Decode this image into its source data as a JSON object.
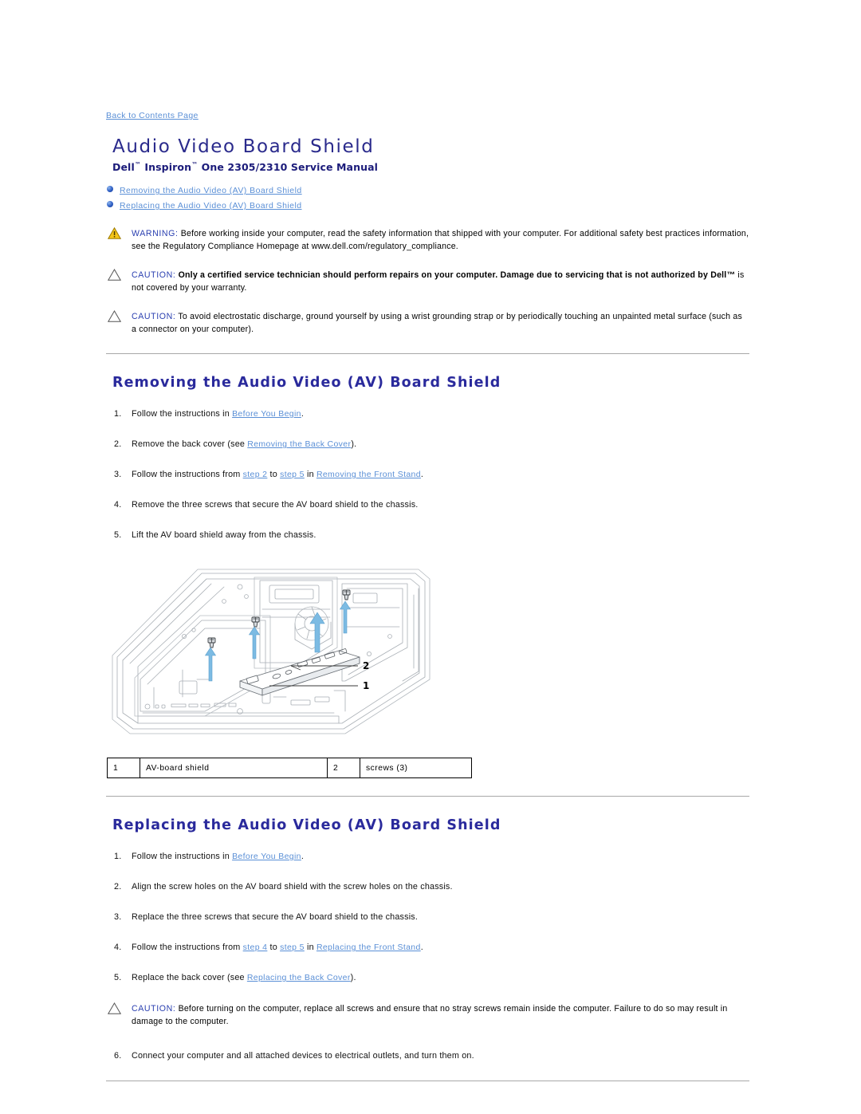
{
  "back_link": "Back to Contents Page",
  "title": "Audio Video Board Shield",
  "subtitle_pre": "Dell",
  "subtitle_tm1": "™",
  "subtitle_mid": " Inspiron",
  "subtitle_tm2": "™",
  "subtitle_post": " One 2305/2310 Service Manual",
  "toc": [
    "Removing the Audio Video (AV) Board Shield",
    "Replacing the Audio Video (AV) Board Shield"
  ],
  "notices_top": [
    {
      "icon": "warning-triangle-icon",
      "type": "warning",
      "label": "WARNING:",
      "text": " Before working inside your computer, read the safety information that shipped with your computer. For additional safety best practices information, see the Regulatory Compliance Homepage at www.dell.com/regulatory_compliance.",
      "bold": false
    },
    {
      "icon": "caution-triangle-icon",
      "type": "caution",
      "label": "CAUTION:",
      "bold_text": " Only a certified service technician should perform repairs on your computer. Damage due to servicing that is not authorized by Dell™",
      "text": " is not covered by your warranty.",
      "bold": true
    },
    {
      "icon": "caution-triangle-icon",
      "type": "caution",
      "label": "CAUTION:",
      "text": " To avoid electrostatic discharge, ground yourself by using a wrist grounding strap or by periodically touching an unpainted metal surface (such as a connector on your computer).",
      "bold": false
    }
  ],
  "section_removing": {
    "heading": "Removing the Audio Video (AV) Board Shield",
    "steps": [
      {
        "parts": [
          {
            "t": "Follow the instructions in ",
            "link": false
          },
          {
            "t": "Before You Begin",
            "link": true
          },
          {
            "t": ".",
            "link": false
          }
        ]
      },
      {
        "parts": [
          {
            "t": "Remove the back cover (see ",
            "link": false
          },
          {
            "t": "Removing the Back Cover",
            "link": true
          },
          {
            "t": ").",
            "link": false
          }
        ]
      },
      {
        "parts": [
          {
            "t": "Follow the instructions from ",
            "link": false
          },
          {
            "t": "step 2",
            "link": true
          },
          {
            "t": " to ",
            "link": false
          },
          {
            "t": "step 5",
            "link": true
          },
          {
            "t": " in ",
            "link": false
          },
          {
            "t": "Removing the Front Stand",
            "link": true
          },
          {
            "t": ".",
            "link": false
          }
        ]
      },
      {
        "parts": [
          {
            "t": "Remove the three screws that secure the AV board shield to the chassis.",
            "link": false
          }
        ]
      },
      {
        "parts": [
          {
            "t": "Lift the AV board shield away from the chassis.",
            "link": false
          }
        ]
      }
    ],
    "figure": {
      "callouts": [
        "1",
        "2"
      ],
      "legend": [
        {
          "num": "1",
          "label": "AV-board shield"
        },
        {
          "num": "2",
          "label": "screws (3)"
        }
      ]
    }
  },
  "section_replacing": {
    "heading": "Replacing the Audio Video (AV) Board Shield",
    "steps": [
      {
        "parts": [
          {
            "t": "Follow the instructions in ",
            "link": false
          },
          {
            "t": "Before You Begin",
            "link": true
          },
          {
            "t": ".",
            "link": false
          }
        ]
      },
      {
        "parts": [
          {
            "t": "Align the screw holes on the AV board shield with the screw holes on the chassis.",
            "link": false
          }
        ]
      },
      {
        "parts": [
          {
            "t": "Replace the three screws that secure the AV board shield to the chassis.",
            "link": false
          }
        ]
      },
      {
        "parts": [
          {
            "t": "Follow the instructions from ",
            "link": false
          },
          {
            "t": "step 4",
            "link": true
          },
          {
            "t": " to ",
            "link": false
          },
          {
            "t": "step 5",
            "link": true
          },
          {
            "t": " in ",
            "link": false
          },
          {
            "t": "Replacing the Front Stand",
            "link": true
          },
          {
            "t": ".",
            "link": false
          }
        ]
      },
      {
        "parts": [
          {
            "t": "Replace the back cover (see ",
            "link": false
          },
          {
            "t": "Replacing the Back Cover",
            "link": true
          },
          {
            "t": ").",
            "link": false
          }
        ]
      }
    ],
    "notice": {
      "icon": "caution-triangle-icon",
      "label": "CAUTION:",
      "text": " Before turning on the computer, replace all screws and ensure that no stray screws remain inside the computer. Failure to do so may result in damage to the computer."
    },
    "final_step": {
      "parts": [
        {
          "t": "Connect your computer and all attached devices to electrical outlets, and turn them on.",
          "link": false
        }
      ]
    }
  },
  "colors": {
    "title": "#2a2a8c",
    "heading": "#2a2a9c",
    "link": "#5a8fd6",
    "notice_label": "#2a3fb0",
    "warning_fill": "#f5c518",
    "rule": "#a8a8a8",
    "figure_line": "#9aa0a6",
    "figure_arrow": "#6fb3e0"
  }
}
